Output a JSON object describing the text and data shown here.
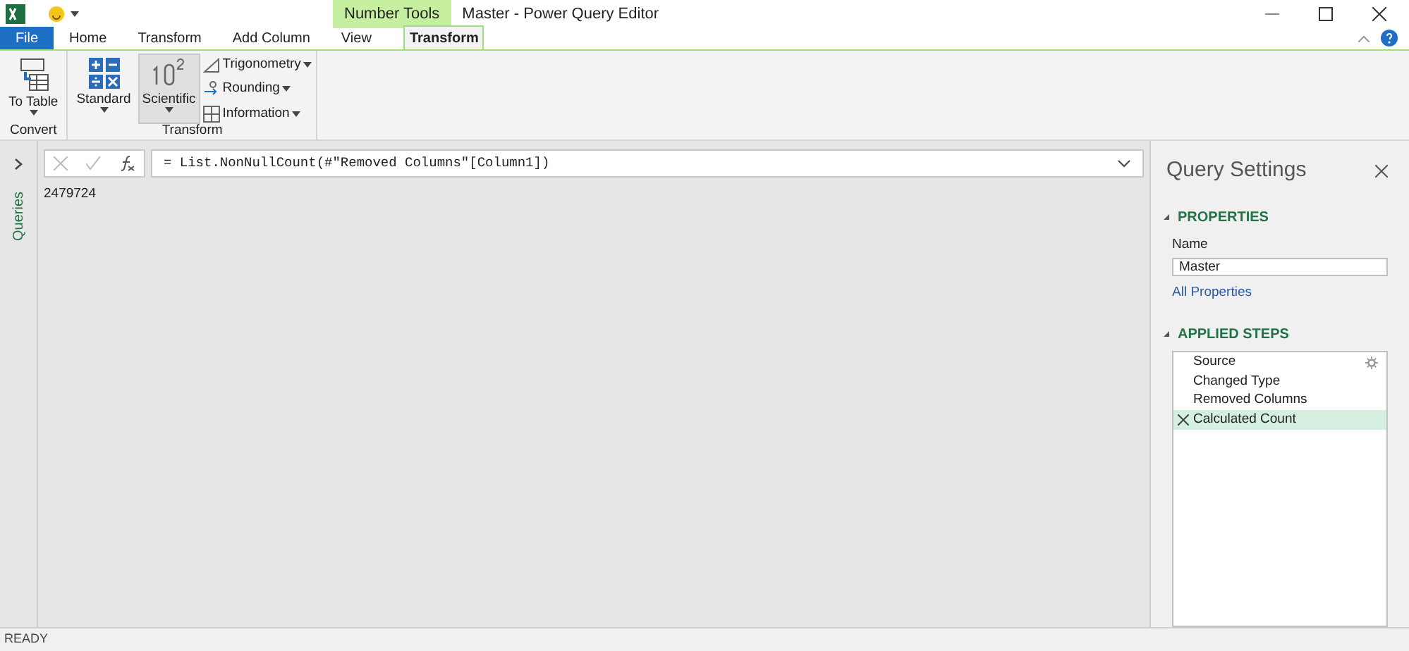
{
  "window": {
    "title": "Master - Power Query Editor",
    "context_tab": "Number Tools"
  },
  "tabs": [
    {
      "label": "File",
      "kind": "file",
      "selected": false
    },
    {
      "label": "Home",
      "kind": "normal",
      "selected": false
    },
    {
      "label": "Transform",
      "kind": "normal",
      "selected": false
    },
    {
      "label": "Add Column",
      "kind": "normal",
      "selected": false
    },
    {
      "label": "View",
      "kind": "normal",
      "selected": false
    },
    {
      "label": "Transform",
      "kind": "context",
      "selected": true
    }
  ],
  "ribbon": {
    "groups": [
      {
        "label": "Convert",
        "large": [
          {
            "label": "To Table",
            "selected": false
          }
        ]
      },
      {
        "label": "Transform",
        "large": [
          {
            "label": "Standard",
            "selected": false
          },
          {
            "label": "Scientific",
            "selected": true
          }
        ],
        "small": [
          {
            "label": "Trigonometry"
          },
          {
            "label": "Rounding"
          },
          {
            "label": "Information"
          }
        ]
      }
    ]
  },
  "queries_pane": {
    "label": "Queries"
  },
  "formula_bar": {
    "formula": "= List.NonNullCount(#\"Removed Columns\"[Column1])"
  },
  "result": "2479724",
  "query_settings": {
    "title": "Query Settings",
    "properties_heading": "PROPERTIES",
    "name_label": "Name",
    "name_value": "Master",
    "all_properties": "All Properties",
    "steps_heading": "APPLIED STEPS",
    "steps": [
      {
        "label": "Source",
        "gear": true,
        "selected": false
      },
      {
        "label": "Changed Type",
        "gear": false,
        "selected": false
      },
      {
        "label": "Removed Columns",
        "gear": false,
        "selected": false
      },
      {
        "label": "Calculated Count",
        "gear": false,
        "selected": true
      }
    ]
  },
  "status_bar": "READY"
}
